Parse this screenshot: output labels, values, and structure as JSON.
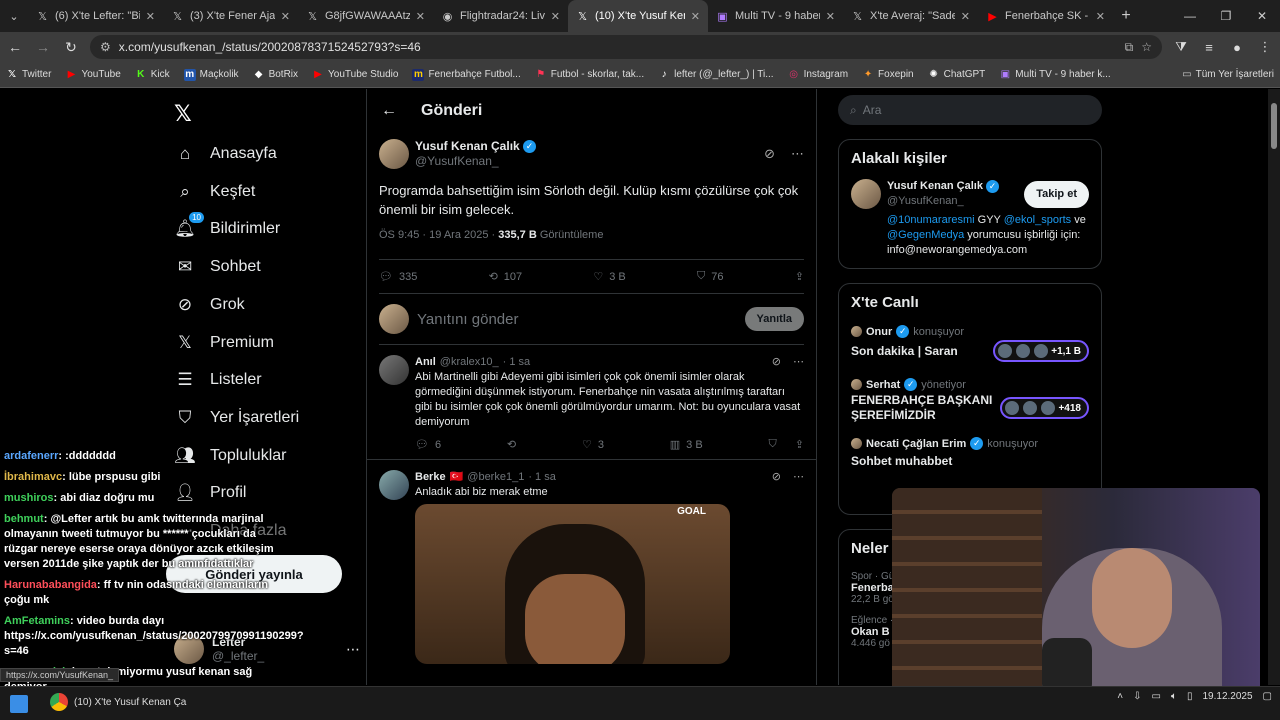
{
  "browser": {
    "tabs": [
      {
        "title": "(6) X'te Lefter: \"Bir şe",
        "icon": "x"
      },
      {
        "title": "(3) X'te Fener Ajans",
        "icon": "x"
      },
      {
        "title": "G8jfGWAWAAAtzVC",
        "icon": "x"
      },
      {
        "title": "Flightradar24: Live Fli",
        "icon": "globe"
      },
      {
        "title": "(10) X'te Yusuf Kenan",
        "icon": "x",
        "active": true
      },
      {
        "title": "Multi TV - 9 haber k",
        "icon": "multitv"
      },
      {
        "title": "X'te Averaj: \"Sadetti",
        "icon": "x"
      },
      {
        "title": "Fenerbahçe SK - You",
        "icon": "youtube"
      }
    ],
    "url": "x.com/yusufkenan_/status/2002087837152452793?s=46",
    "bookmarks": [
      {
        "label": "Twitter",
        "icon": "x"
      },
      {
        "label": "YouTube",
        "icon": "youtube"
      },
      {
        "label": "Kick",
        "icon": "kick"
      },
      {
        "label": "Maçkolik",
        "icon": "mackolik"
      },
      {
        "label": "BotRix",
        "icon": "botrix"
      },
      {
        "label": "YouTube Studio",
        "icon": "ytstudio"
      },
      {
        "label": "Fenerbahçe Futbol...",
        "icon": "fb"
      },
      {
        "label": "Futbol - skorlar, tak...",
        "icon": "flashscore"
      },
      {
        "label": "lefter (@_lefter_) | Ti...",
        "icon": "tiktok"
      },
      {
        "label": "Instagram",
        "icon": "instagram"
      },
      {
        "label": "Foxepin",
        "icon": "foxepin"
      },
      {
        "label": "ChatGPT",
        "icon": "chatgpt"
      },
      {
        "label": "Multi TV - 9 haber k...",
        "icon": "multitv"
      }
    ],
    "all_bookmarks": "Tüm Yer İşaretleri"
  },
  "nav": {
    "items": [
      {
        "label": "Anasayfa",
        "icon": "home-icon"
      },
      {
        "label": "Keşfet",
        "icon": "search-icon"
      },
      {
        "label": "Bildirimler",
        "icon": "bell-icon",
        "badge": "10"
      },
      {
        "label": "Sohbet",
        "icon": "mail-icon"
      },
      {
        "label": "Grok",
        "icon": "grok-icon"
      },
      {
        "label": "Premium",
        "icon": "x-icon"
      },
      {
        "label": "Listeler",
        "icon": "list-icon"
      },
      {
        "label": "Yer İşaretleri",
        "icon": "bookmark-icon"
      },
      {
        "label": "Topluluklar",
        "icon": "people-icon"
      },
      {
        "label": "Profil",
        "icon": "person-icon"
      },
      {
        "label": "Daha fazla",
        "icon": "more-icon"
      }
    ],
    "post_button": "Gönderi yayınla",
    "account": {
      "name": "Lefter",
      "handle": "@_lefter_"
    }
  },
  "post": {
    "header": "Gönderi",
    "author": "Yusuf Kenan Çalık",
    "handle": "@YusufKenan_",
    "text": "Programda bahsettiğim isim Sörloth değil. Kulüp kısmı çözülürse çok çok önemli bir isim gelecek.",
    "time": "ÖS 9:45 · 19 Ara 2025 · ",
    "views": "335,7 B",
    "views_label": "Görüntüleme",
    "replies": "335",
    "reposts": "107",
    "likes": "3 B",
    "bookmarks": "76",
    "reply_placeholder": "Yanıtını gönder",
    "reply_button": "Yanıtla"
  },
  "replies": [
    {
      "name": "Anıl",
      "handle": "@kralex10_",
      "time": "· 1 sa",
      "text": "Abi Martinelli gibi Adeyemi gibi isimleri çok çok önemli isimler olarak görmediğini düşünmek istiyorum. Fenerbahçe nin vasata alıştırılmış taraftarı gibi bu isimler çok çok önemli görülmüyordur umarım. Not: bu oyunculara vasat demiyorum",
      "replies": "6",
      "likes": "3",
      "views": "3 B"
    },
    {
      "name": "Berke",
      "flag": "🇹🇷",
      "handle": "@berke1_1",
      "time": "· 1 sa",
      "text": "Anladık abi biz merak etme",
      "gif_label": "GOAL"
    }
  ],
  "right": {
    "search_placeholder": "Ara",
    "relevant_title": "Alakalı kişiler",
    "person": {
      "name": "Yusuf Kenan Çalık",
      "handle": "@YusufKenan_",
      "follow": "Takip et",
      "bio_p1": "@10numararesmi",
      "bio_p2": " GYY ",
      "bio_p3": "@ekol_sports",
      "bio_p4": " ve ",
      "bio_p5": "@GegenMedya",
      "bio_p6": " yorumcusu işbirliği için: info@neworangemedya.com"
    },
    "live_title": "X'te Canlı",
    "live": [
      {
        "host": "Onur",
        "role": "konuşuyor",
        "title": "Son dakika | Saran",
        "count": "+1,1 B"
      },
      {
        "host": "Serhat",
        "role": "yönetiyor",
        "title": "FENERBAHÇE BAŞKANI ŞEREFİMİZDİR",
        "count": "+418"
      },
      {
        "host": "Necati Çağlan Erim",
        "role": "konuşuyor",
        "title": "Sohbet muhabbet"
      }
    ],
    "trends_title": "Neler",
    "trends": [
      {
        "meta": "Spor · Gü",
        "name": "Fenerba",
        "count": "22,2 B gö"
      },
      {
        "meta": "Eğlence ·",
        "name": "Okan B",
        "count": "4.446 gö"
      }
    ]
  },
  "chat": [
    {
      "user": "ardafenerr",
      "color": "#5aa7ff",
      "msg": ": :ddddddd"
    },
    {
      "user": "İbrahimavc",
      "color": "#e0b84a",
      "msg": ": lübe prspusu gibi"
    },
    {
      "user": "mushiros",
      "color": "#3fd05b",
      "msg": ": abi diaz doğru mu"
    },
    {
      "user": "behmut",
      "color": "#3fd05b",
      "msg": ": @Lefter artık bu amk twitterında marjinal olmayanın tweeti tutmuyor bu ****** çocukları da rüzgar nereye eserse oraya dönüyor azcık etkileşim versen 2011de şike yaptık der bu amınfıdattıklar"
    },
    {
      "user": "Harunababangida",
      "color": "#ff4f5a",
      "msg": ": ff tv nin odasındaki elemanların çoğu mk"
    },
    {
      "user": "AmFetamins",
      "color": "#3fd05b",
      "msg": ": video burda dayı https://x.com/yusufkenan_/status/2002079970991190299?s=46"
    },
    {
      "user": "emresandal",
      "color": "#3fd05b",
      "msg": ": kanat demiyormu yusuf kenan sağ demiyor"
    }
  ],
  "status_url": "https://x.com/YusufKenan_",
  "taskbar": {
    "app_label": "(10) X'te Yusuf Kenan Ça",
    "date": "19.12.2025"
  }
}
